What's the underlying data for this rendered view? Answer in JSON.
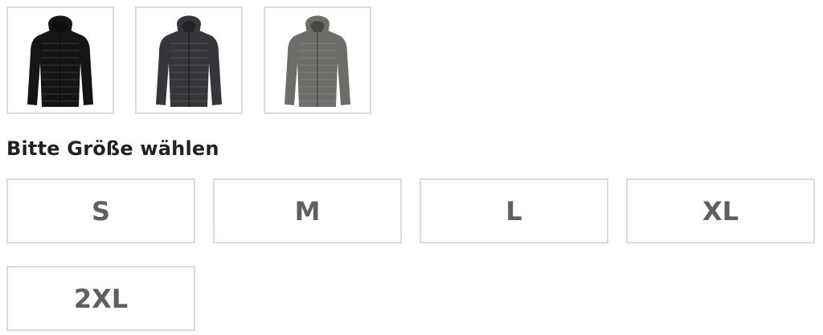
{
  "colour_swatches": [
    {
      "icon": "black-jacket-icon",
      "color": "#151515"
    },
    {
      "icon": "dark-grey-jacket-icon",
      "color": "#35353b"
    },
    {
      "icon": "grey-jacket-icon",
      "color": "#6d6d69"
    }
  ],
  "size_selector": {
    "heading": "Bitte Größe wählen",
    "options": [
      "S",
      "M",
      "L",
      "XL",
      "2XL"
    ]
  },
  "colors": {
    "border": "#d8dbe2",
    "size_text": "#5f5f5f",
    "heading_text": "#222222"
  }
}
